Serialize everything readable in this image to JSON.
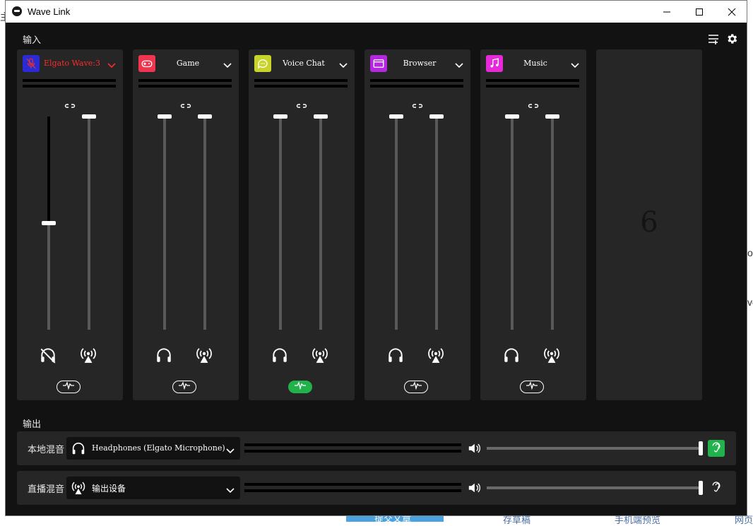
{
  "window": {
    "title": "Wave Link"
  },
  "sections": {
    "inputs": "输入",
    "outputs": "输出"
  },
  "channels": [
    {
      "name": "Elgato Wave:3",
      "icon": "mic-muted-icon",
      "color": "#2b2bd6",
      "name_color": "#ff2a2a",
      "monitor_level": 0.5,
      "stream_level": 1.0,
      "monitor_muted": true,
      "wave_active": false
    },
    {
      "name": "Game",
      "icon": "gamepad-icon",
      "color": "#f0364f",
      "name_color": "#ffffff",
      "monitor_level": 1.0,
      "stream_level": 1.0,
      "monitor_muted": false,
      "wave_active": false
    },
    {
      "name": "Voice Chat",
      "icon": "chat-bubble-icon",
      "color": "#c8d42a",
      "name_color": "#ffffff",
      "monitor_level": 1.0,
      "stream_level": 1.0,
      "monitor_muted": false,
      "wave_active": true
    },
    {
      "name": "Browser",
      "icon": "browser-window-icon",
      "color": "#b428e0",
      "name_color": "#ffffff",
      "monitor_level": 1.0,
      "stream_level": 1.0,
      "monitor_muted": false,
      "wave_active": false
    },
    {
      "name": "Music",
      "icon": "music-note-icon",
      "color": "#e62ad8",
      "name_color": "#ffffff",
      "monitor_level": 1.0,
      "stream_level": 1.0,
      "monitor_muted": false,
      "wave_active": false
    }
  ],
  "placeholder_channel": {
    "number": "6"
  },
  "outputs": [
    {
      "label": "本地混音",
      "device": "Headphones (Elgato Microphone)",
      "device_icon": "headphones-icon",
      "volume": 1.0,
      "listen_active": true
    },
    {
      "label": "直播混音",
      "device": "输出设备",
      "device_icon": "broadcast-icon",
      "volume": 1.0,
      "listen_active": false
    }
  ],
  "background": {
    "left_fragment": "主",
    "right_fragment_1": "o",
    "right_fragment_2": "vo",
    "bottom_items": [
      "提交文章",
      "存草稿",
      "手机端预览",
      "网页"
    ]
  },
  "colors": {
    "accent_green": "#22b24c",
    "panel": "#262626",
    "window_bg": "#121212"
  }
}
